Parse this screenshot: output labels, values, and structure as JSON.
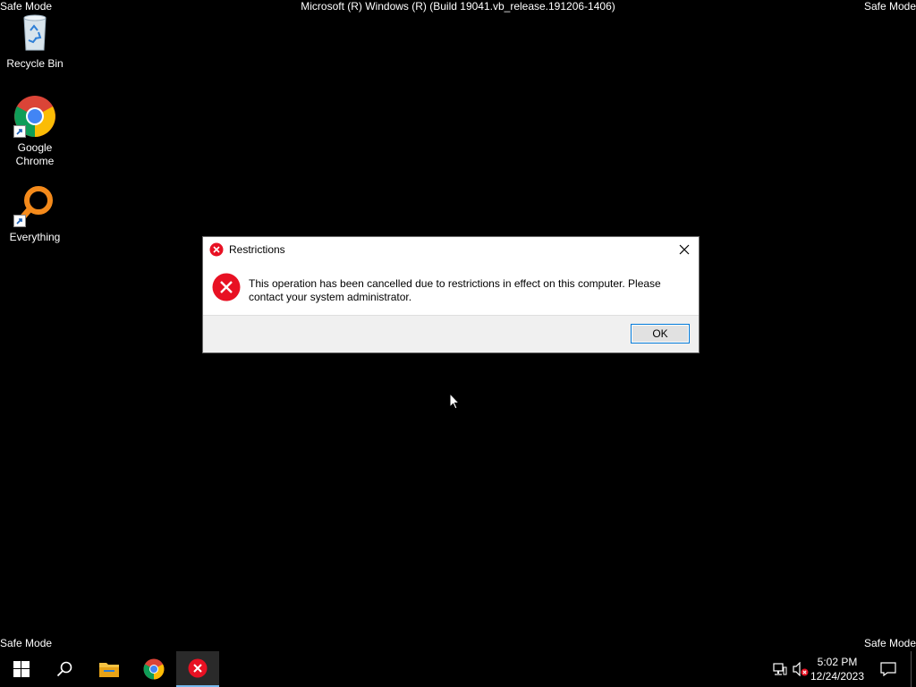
{
  "watermark": {
    "safe_mode_top_left": "Safe Mode",
    "safe_mode_top_right": "Safe Mode",
    "safe_mode_bottom_left": "Safe Mode",
    "safe_mode_bottom_right": "Safe Mode",
    "build": "Microsoft (R) Windows (R) (Build 19041.vb_release.191206-1406)"
  },
  "desktop": {
    "icons": [
      {
        "label": "Recycle Bin",
        "icon": "recycle-bin-icon"
      },
      {
        "label": "Google Chrome",
        "icon": "chrome-icon"
      },
      {
        "label": "Everything",
        "icon": "everything-search-icon"
      }
    ]
  },
  "dialog": {
    "title": "Restrictions",
    "message": "This operation has been cancelled due to restrictions in effect on this computer. Please contact your system administrator.",
    "ok_label": "OK",
    "icon": "error-icon"
  },
  "taskbar": {
    "items": [
      "start-icon",
      "search-icon",
      "file-explorer-icon",
      "chrome-icon",
      "error-icon"
    ],
    "clock_time": "5:02 PM",
    "clock_date": "12/24/2023"
  },
  "colors": {
    "desktop_bg": "#000000",
    "error_red": "#e81123",
    "accent": "#0078d7"
  }
}
